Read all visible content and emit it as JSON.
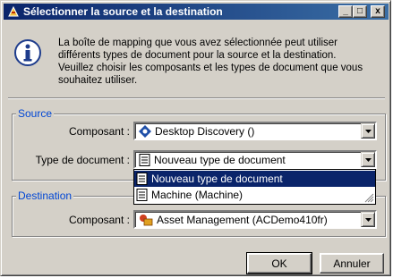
{
  "window": {
    "title": "Sélectionner la source et la destination",
    "controls": {
      "minimize": "_",
      "maximize": "□",
      "close": "x"
    }
  },
  "info": {
    "icon": "info-icon",
    "lines": [
      "La boîte de mapping que vous avez sélectionnée peut utiliser",
      "différents types de document pour la source et la destination.",
      "Veuillez choisir les composants et les types de document que vous",
      "souhaitez utiliser."
    ]
  },
  "source": {
    "legend": "Source",
    "component_label": "Composant :",
    "component_value": "Desktop Discovery ()",
    "doctype_label": "Type de document :",
    "doctype_value": "Nouveau type de document"
  },
  "dropdown": {
    "items": [
      {
        "label": "Nouveau type de document",
        "selected": true
      },
      {
        "label": "Machine (Machine)",
        "selected": false
      }
    ]
  },
  "destination": {
    "legend": "Destination",
    "component_label": "Composant :",
    "component_value": "Asset Management (ACDemo410fr)"
  },
  "buttons": {
    "ok": "OK",
    "cancel": "Annuler"
  },
  "colors": {
    "title_bar_start": "#0a246a",
    "title_bar_end": "#3a6ea5",
    "group_legend": "#0046d5",
    "selection": "#0a246a"
  }
}
